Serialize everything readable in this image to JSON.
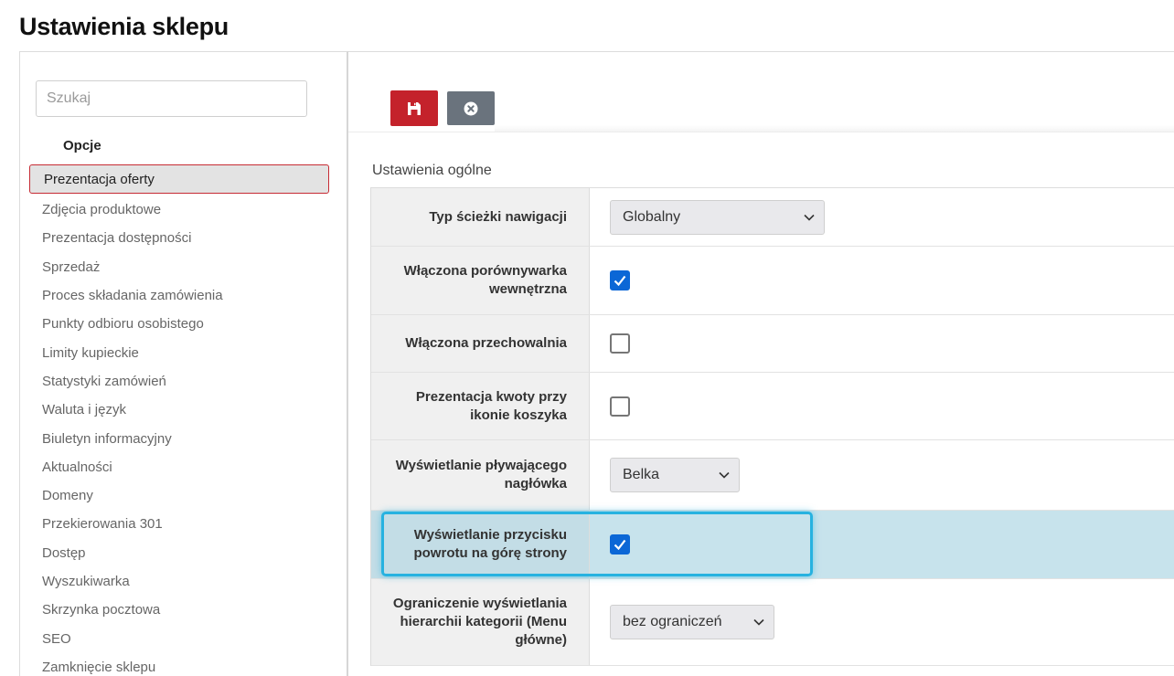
{
  "page": {
    "title": "Ustawienia sklepu"
  },
  "sidebar": {
    "search_placeholder": "Szukaj",
    "heading": "Opcje",
    "items": [
      {
        "label": "Prezentacja oferty",
        "active": true
      },
      {
        "label": "Zdjęcia produktowe"
      },
      {
        "label": "Prezentacja dostępności"
      },
      {
        "label": "Sprzedaż"
      },
      {
        "label": "Proces składania zamówienia"
      },
      {
        "label": "Punkty odbioru osobistego"
      },
      {
        "label": "Limity kupieckie"
      },
      {
        "label": "Statystyki zamówień"
      },
      {
        "label": "Waluta i język"
      },
      {
        "label": "Biuletyn informacyjny"
      },
      {
        "label": "Aktualności"
      },
      {
        "label": "Domeny"
      },
      {
        "label": "Przekierowania 301"
      },
      {
        "label": "Dostęp"
      },
      {
        "label": "Wyszukiwarka"
      },
      {
        "label": "Skrzynka pocztowa"
      },
      {
        "label": "SEO"
      },
      {
        "label": "Zamknięcie sklepu"
      }
    ]
  },
  "toolbar": {
    "save_icon": "floppy-disk-icon",
    "cancel_icon": "close-circle-icon",
    "save_color": "#c4222b",
    "cancel_color": "#6a737d"
  },
  "settings": {
    "section_title": "Ustawienia ogólne",
    "rows": [
      {
        "label": "Typ ścieżki nawigacji",
        "type": "select",
        "value": "Globalny"
      },
      {
        "label": "Włączona porównywarka wewnętrzna",
        "type": "checkbox",
        "checked": true
      },
      {
        "label": "Włączona przechowalnia",
        "type": "checkbox",
        "checked": false
      },
      {
        "label": "Prezentacja kwoty przy ikonie koszyka",
        "type": "checkbox",
        "checked": false
      },
      {
        "label": "Wyświetlanie pływającego nagłówka",
        "type": "select",
        "value": "Belka"
      },
      {
        "label": "Wyświetlanie przycisku powrotu na górę strony",
        "type": "checkbox",
        "checked": true,
        "highlighted": true
      },
      {
        "label": "Ograniczenie wyświetlania hierarchii kategorii (Menu główne)",
        "type": "select",
        "value": "bez ograniczeń"
      }
    ]
  },
  "colors": {
    "accent_red": "#c4222b",
    "checkbox_blue": "#0b67d6",
    "highlight_border": "#27b2e0"
  }
}
